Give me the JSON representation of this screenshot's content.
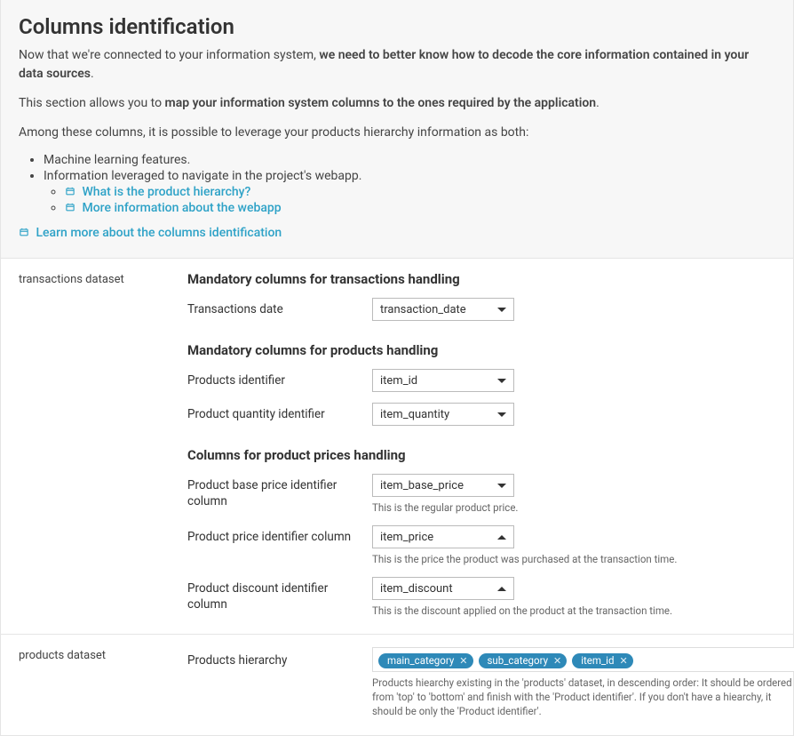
{
  "header": {
    "title": "Columns identification",
    "p1a": "Now that we're connected to your information system, ",
    "p1b": "we need to better know how to decode the core information contained in your data sources",
    "p1c": ".",
    "p2a": "This section allows you to ",
    "p2b": "map your information system columns to the ones required by the application",
    "p2c": ".",
    "p3": "Among these columns, it is possible to leverage your products hierarchy information as both:",
    "bullet1": "Machine learning features.",
    "bullet2": "Information leveraged to navigate in the project's webapp.",
    "link_hierarchy": "What is the product hierarchy?",
    "link_webapp": "More information about the webapp",
    "link_learn": "Learn more about the columns identification"
  },
  "transactions": {
    "dataset_label": "transactions dataset",
    "grp_trans_heading": "Mandatory columns for transactions handling",
    "trans_date_label": "Transactions date",
    "trans_date_value": "transaction_date",
    "grp_prod_heading": "Mandatory columns for products handling",
    "prod_id_label": "Products identifier",
    "prod_id_value": "item_id",
    "prod_qty_label": "Product quantity identifier",
    "prod_qty_value": "item_quantity",
    "grp_price_heading": "Columns for product prices handling",
    "base_price_label": "Product base price identifier column",
    "base_price_value": "item_base_price",
    "base_price_help": "This is the regular product price.",
    "price_label": "Product price identifier column",
    "price_value": "item_price",
    "price_help": "This is the price the product was purchased at the transaction time.",
    "discount_label": "Product discount identifier column",
    "discount_value": "item_discount",
    "discount_help": "This is the discount applied on the product at the transaction time."
  },
  "products": {
    "dataset_label": "products dataset",
    "hierarchy_label": "Products hierarchy",
    "chips": {
      "c0": "main_category",
      "c1": "sub_category",
      "c2": "item_id"
    },
    "hierarchy_help": "Products hiearchy existing in the 'products' dataset, in descending order: It should be ordered from 'top' to 'bottom' and finish with the 'Product identifier'. If you don't have a hiearchy, it should be only the 'Product identifier'."
  }
}
